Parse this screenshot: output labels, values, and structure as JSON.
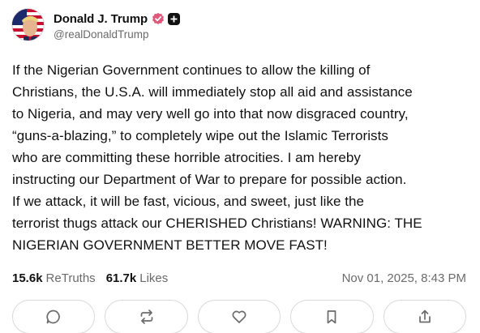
{
  "author": {
    "display_name": "Donald J. Trump",
    "handle": "@realDonaldTrump",
    "avatar_icon": "profile-photo-flag",
    "verified_icon": "verified-badge-icon",
    "verified_color": "#e0577a",
    "plus_icon": "plus-badge-icon"
  },
  "post": {
    "text": "If the Nigerian Government continues to allow the killing of\nChristians, the U.S.A. will immediately stop all aid and assistance\nto Nigeria, and may very well go into that now disgraced country,\n“guns-a-blazing,” to completely wipe out the Islamic Terrorists\nwho are committing these horrible atrocities. I am hereby\ninstructing our Department of War to prepare for possible action.\nIf we attack, it will be fast, vicious, and sweet, just like the\nterrorist thugs attack our CHERISHED Christians! WARNING: THE\nNIGERIAN GOVERNMENT BETTER MOVE FAST!"
  },
  "stats": {
    "retruths_count": "15.6k",
    "retruths_label": "ReTruths",
    "likes_count": "61.7k",
    "likes_label": "Likes",
    "timestamp": "Nov 01, 2025, 8:43 PM"
  },
  "actions": [
    {
      "icon": "reply-icon"
    },
    {
      "icon": "retruth-icon"
    },
    {
      "icon": "like-heart-icon"
    },
    {
      "icon": "bookmark-icon"
    },
    {
      "icon": "share-icon"
    }
  ]
}
